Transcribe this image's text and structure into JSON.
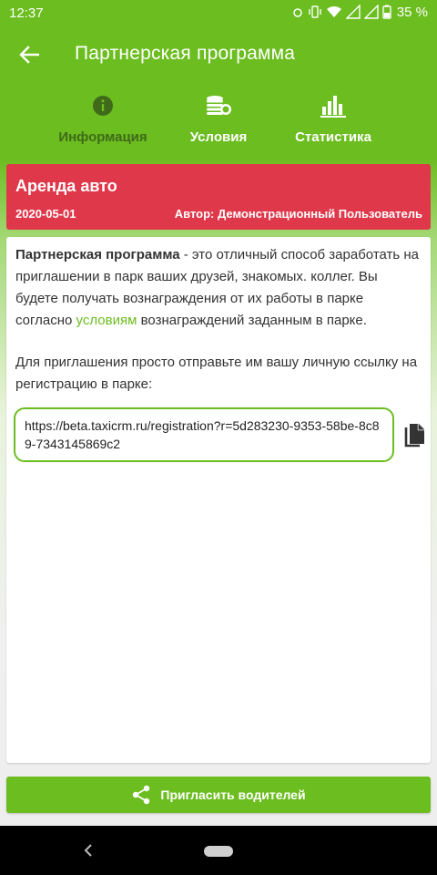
{
  "status_bar": {
    "time": "12:37",
    "battery_percent": "35 %"
  },
  "app_bar": {
    "title": "Партнерская программа",
    "back_icon": "arrow-back-icon"
  },
  "tabs": [
    {
      "label": "Информация",
      "icon": "info-icon",
      "active": true
    },
    {
      "label": "Условия",
      "icon": "coins-icon",
      "active": false
    },
    {
      "label": "Статистика",
      "icon": "bar-chart-icon",
      "active": false
    }
  ],
  "header_card": {
    "title": "Аренда авто",
    "date": "2020-05-01",
    "author": "Автор: Демонстрационный Пользователь"
  },
  "content": {
    "intro_bold": "Партнерская программа",
    "intro_rest_1": " - это отличный способ заработать на приглашении в парк ваших друзей, знакомых. коллег. Вы будете получать вознаграждения от их работы в парке согласно ",
    "intro_link": "условиям",
    "intro_rest_2": " вознаграждений заданным в парке.",
    "invite_text": "Для приглашения просто отправьте им вашу личную ссылку на регистрацию в парке:",
    "referral_link": "https://beta.taxicrm.ru/registration?r=5d283230-9353-58be-8c89-7343145869c2"
  },
  "invite_button": {
    "label": "Пригласить водителей",
    "icon": "share-icon"
  },
  "colors": {
    "primary_green": "#6cbd20",
    "header_red": "#e0384b",
    "active_tab_text": "#3f6a19"
  }
}
